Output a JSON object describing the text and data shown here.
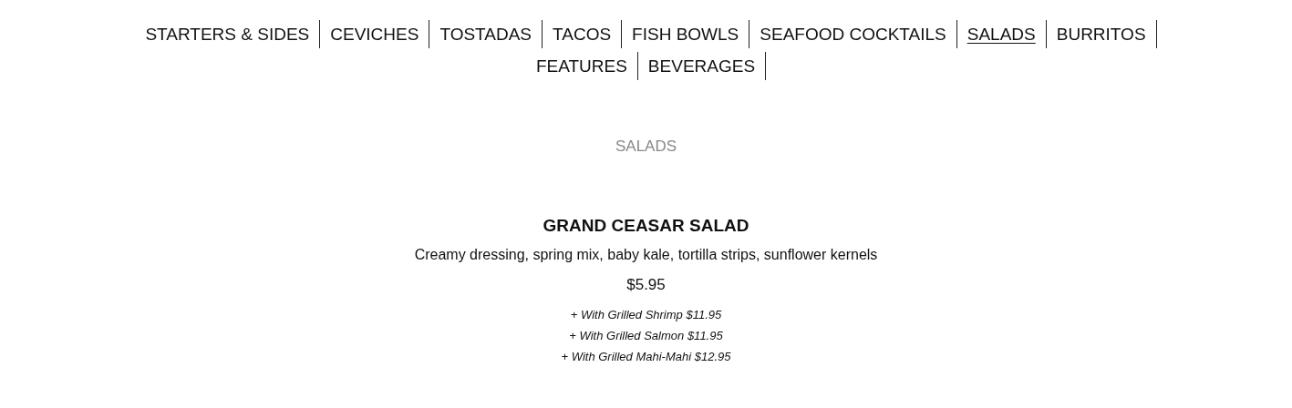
{
  "nav": [
    {
      "label": "STARTERS & SIDES",
      "selected": false
    },
    {
      "label": "CEVICHES",
      "selected": false
    },
    {
      "label": "TOSTADAS",
      "selected": false
    },
    {
      "label": "TACOS",
      "selected": false
    },
    {
      "label": "FISH BOWLS",
      "selected": false
    },
    {
      "label": "SEAFOOD COCKTAILS",
      "selected": false
    },
    {
      "label": "SALADS",
      "selected": true
    },
    {
      "label": "BURRITOS",
      "selected": false
    },
    {
      "label": "FEATURES",
      "selected": false
    },
    {
      "label": "BEVERAGES",
      "selected": false
    }
  ],
  "section": {
    "title": "SALADS",
    "items": [
      {
        "name": "GRAND CEASAR SALAD",
        "description": "Creamy dressing, spring mix, baby kale, tortilla strips, sunflower kernels",
        "price": "$5.95",
        "options": [
          "+ With Grilled Shrimp $11.95",
          "+ With Grilled Salmon $11.95",
          "+ With Grilled Mahi-Mahi $12.95"
        ]
      }
    ]
  }
}
